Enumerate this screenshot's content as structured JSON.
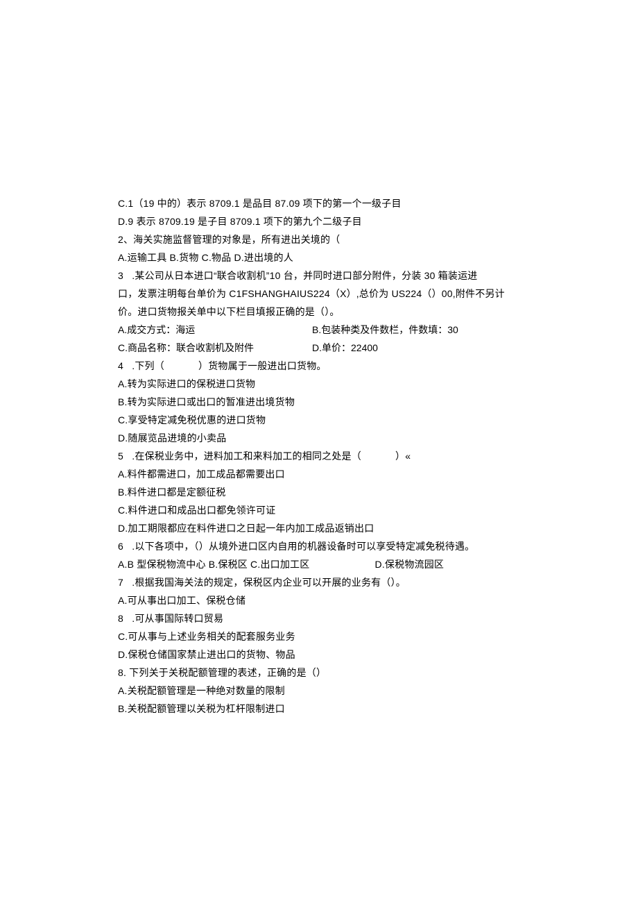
{
  "lines": {
    "l01": "C.1（19 中的）表示 8709.1 是品目 87.09 项下的第一个一级子目",
    "l02": "D.9 表示 8709.19 是子目 8709.1 项下的第九个二级子目",
    "l03": "2、海关实施监督管理的对象是，所有进出关境的（",
    "l04": "A.运输工具 B.货物 C.物品 D.进出境的人",
    "l05": "3   .某公司从日本进口“联合收割机”10 台，并同时进口部分附件，分装 30 箱装运进",
    "l06": "口，发票注明每台单价为 C1FSHANGHAIUS224（X）,总价为 US224（）00,附件不另计",
    "l07": "价。进口货物报关单中以下栏目填报正确的是（）。",
    "l08a": "A.成交方式：海运",
    "l08b": "B.包装种类及件数栏，件数填：30",
    "l09a": "C.商品名称：联合收割机及附件",
    "l09b": "D.单价：22400",
    "l10": "4   .下列（            ）货物属于一般进出口货物。",
    "l11": "A.转为实际进口的保税进口货物",
    "l12": "B.转为实际进口或出口的暂准进出境货物",
    "l13": "C.享受特定减免税优惠的进口货物",
    "l14": "D.随展览品进境的小卖品",
    "l15": "5   .在保税业务中，进料加工和来料加工的相同之处是（            ）«",
    "l16": "A.料件都需进口，加工成品都需要出口",
    "l17": "B.料件进口都是定额征税",
    "l18": "C.料件进口和成品出口都免领许可证",
    "l19": "D.加工期限都应在料件进口之日起一年内加工成品返销出口",
    "l20": "6   .以下各项中，（）从境外进口区内自用的机器设备时可以享受特定减免税待遇。",
    "l21": "A.B 型保税物流中心 B.保税区 C.出口加工区                       D.保税物流园区",
    "l22": "7   .根据我国海关法的规定，保税区内企业可以开展的业务有（）。",
    "l23": "A.可从事出口加工、保税仓储",
    "l24": "8   .可从事国际转口贸易",
    "l25": "C.可从事与上述业务相关的配套服务业务",
    "l26": "D.保税仓储国家禁止进出口的货物、物品",
    "l27": "8. 下列关于关税配额管理的表述，正确的是（）",
    "l28": "A.关税配额管理是一种绝对数量的限制",
    "l29": "B.关税配额管理以关税为杠杆限制进口"
  }
}
